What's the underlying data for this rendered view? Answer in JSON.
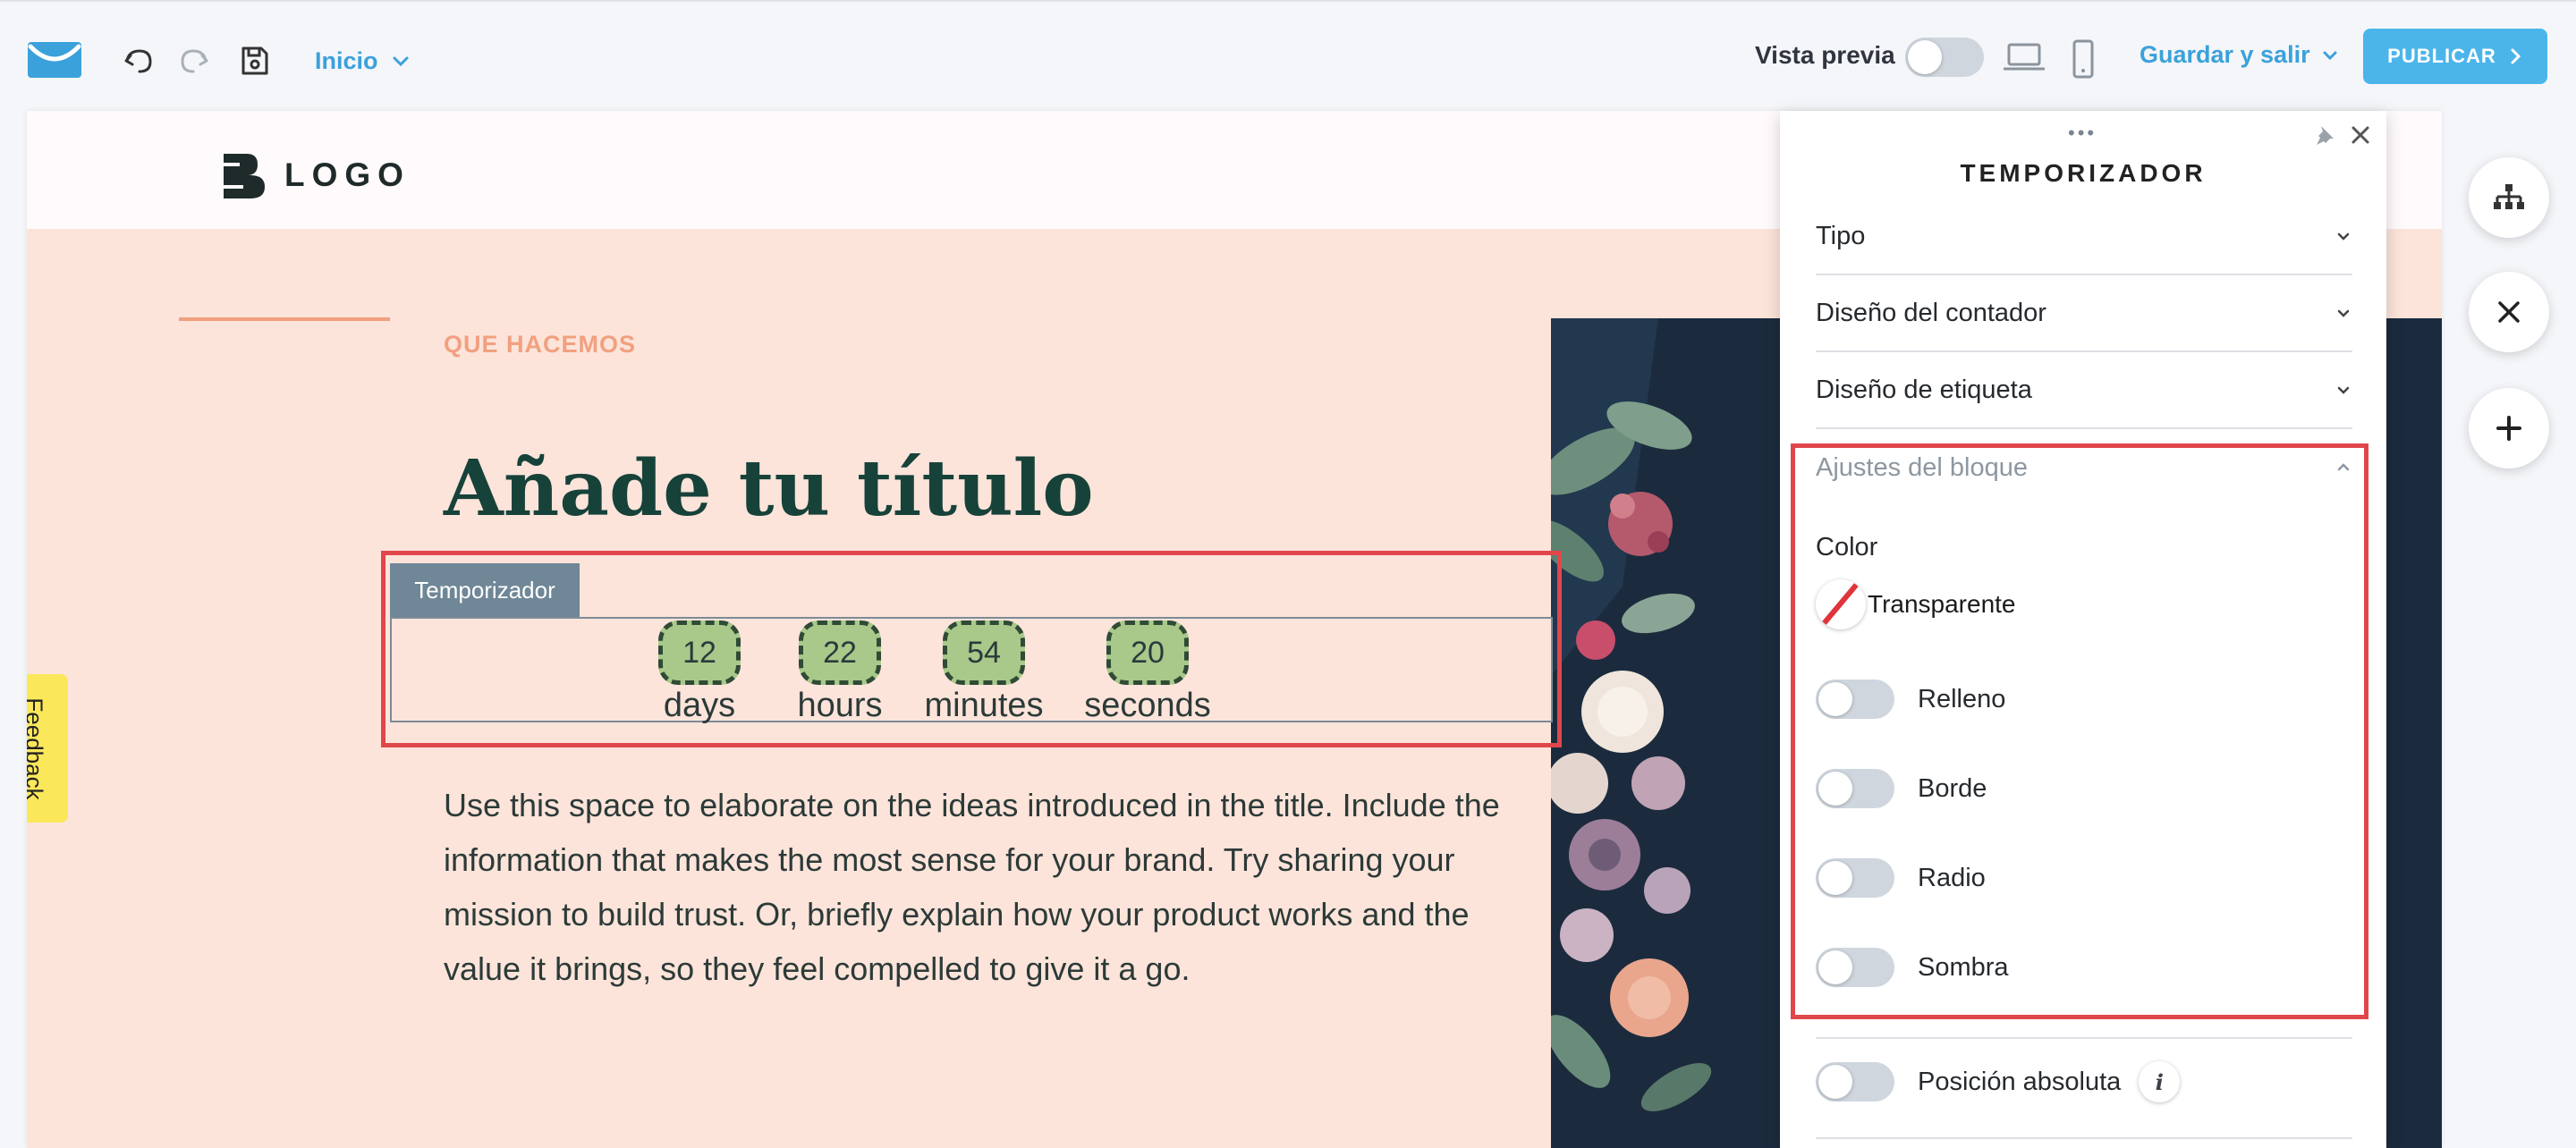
{
  "toolbar": {
    "page_select": "Inicio",
    "preview_label": "Vista previa",
    "save_exit": "Guardar y salir",
    "publish": "PUBLICAR",
    "icons": [
      "getresponse-mail-logo",
      "undo-icon",
      "redo-icon",
      "save-icon",
      "laptop-icon",
      "mobile-icon"
    ]
  },
  "page": {
    "logo_text": "LOGO",
    "eyebrow": "QUE HACEMOS",
    "title": "Añade tu título",
    "body": "Use this space to elaborate on the ideas introduced in the title. Include the information that makes the most sense for your brand. Try sharing your mission to build trust. Or, briefly explain how your product works and the value it brings, so they feel compelled to give it a go."
  },
  "timer": {
    "tab_label": "Temporizador",
    "units": [
      {
        "value": "12",
        "label": "days"
      },
      {
        "value": "22",
        "label": "hours"
      },
      {
        "value": "54",
        "label": "minutes"
      },
      {
        "value": "20",
        "label": "seconds"
      }
    ],
    "digit_color": "#a8c98a"
  },
  "panel": {
    "title": "TEMPORIZADOR",
    "sections": [
      "Tipo",
      "Diseño del contador",
      "Diseño de etiqueta",
      "Ajustes del bloque"
    ],
    "color_label": "Color",
    "color_value": "Transparente",
    "toggles": [
      {
        "label": "Relleno",
        "on": false
      },
      {
        "label": "Borde",
        "on": false
      },
      {
        "label": "Radio",
        "on": false
      },
      {
        "label": "Sombra",
        "on": false
      }
    ],
    "absolute_position": {
      "label": "Posición absoluta",
      "on": false
    }
  },
  "feedback_label": "Feedback",
  "colors": {
    "accent_blue": "#3ba1db",
    "publish_bg": "#4bb5ea",
    "selection_red": "#e0474c",
    "hero_bg": "#fce4da",
    "title_green": "#17423a"
  }
}
